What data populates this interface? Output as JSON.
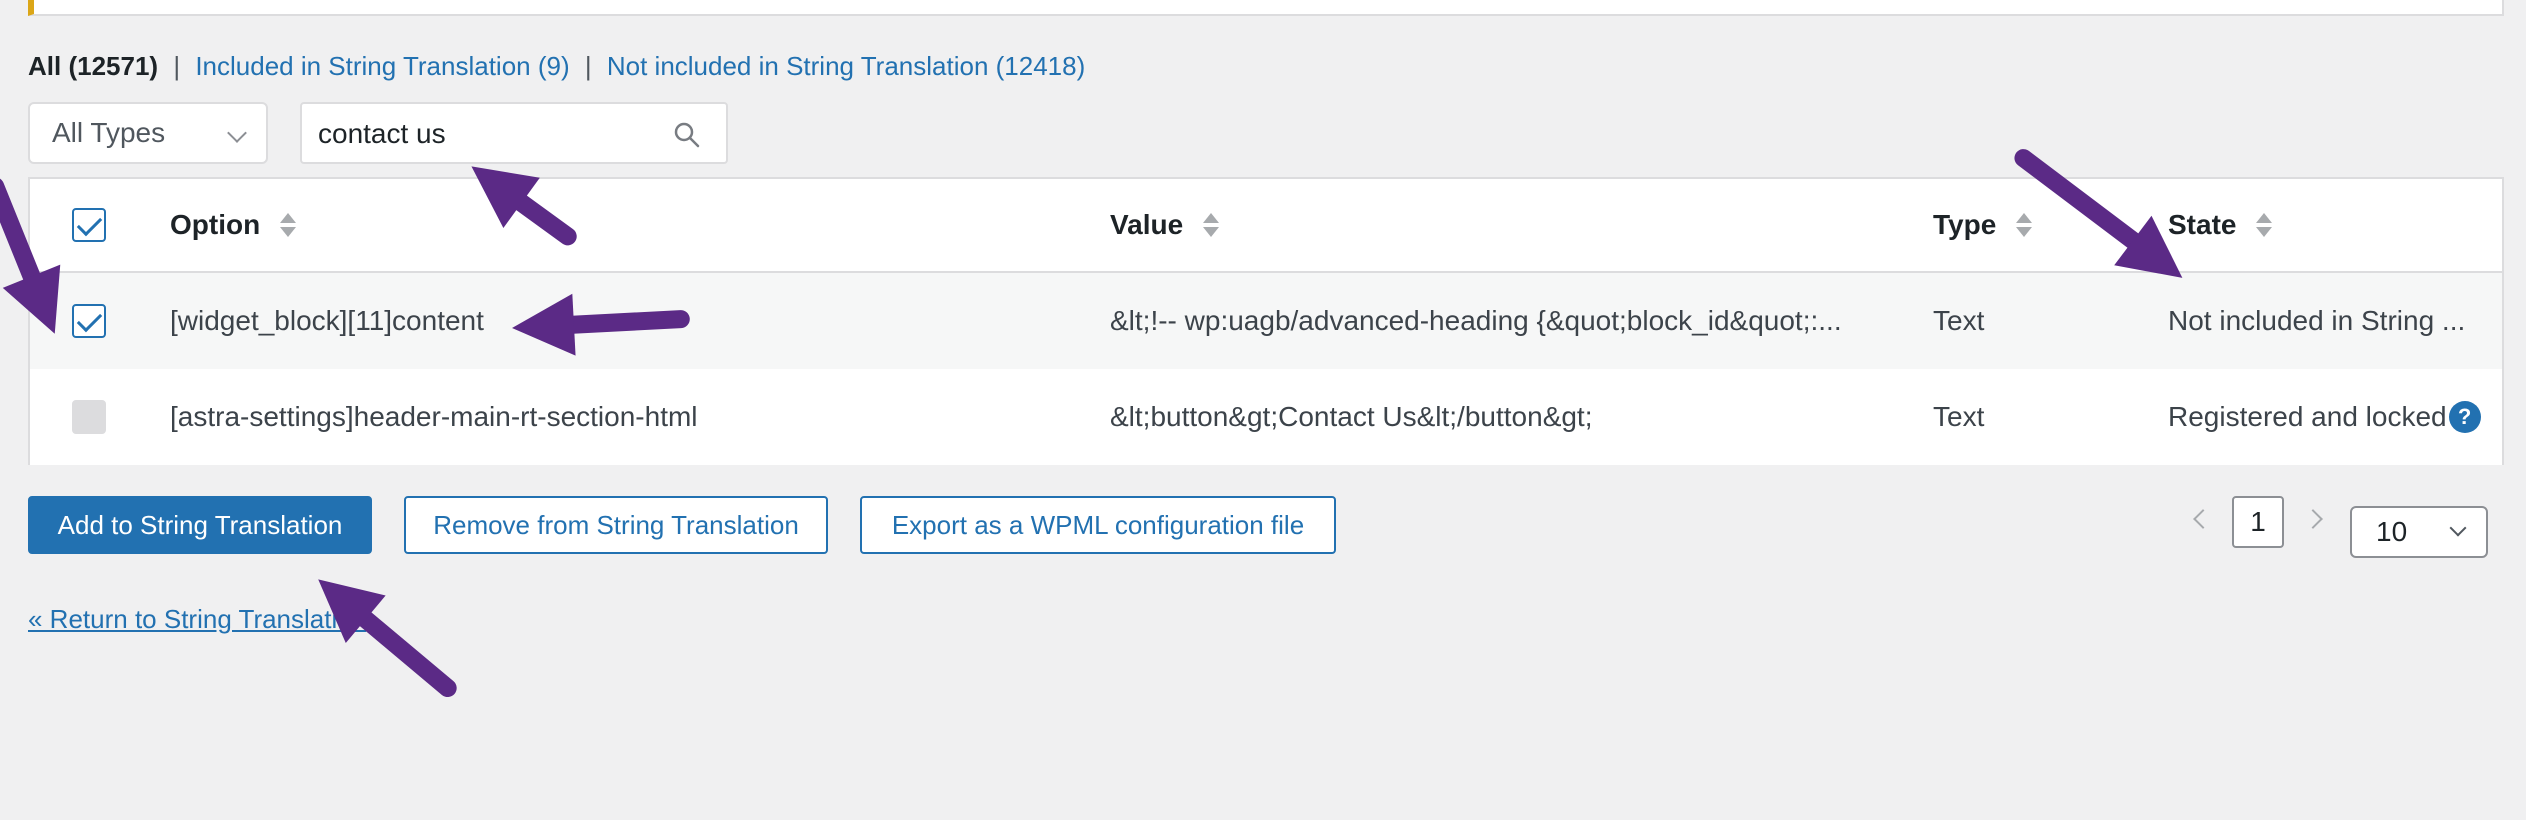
{
  "filters": {
    "all": "All (12571)",
    "sep1": "|",
    "included": "Included in String Translation (9)",
    "sep2": "|",
    "not_included": "Not included in String Translation (12418)"
  },
  "type_select": {
    "value": "All Types"
  },
  "search": {
    "value": "contact us"
  },
  "table": {
    "headers": {
      "option": "Option",
      "value": "Value",
      "type": "Type",
      "state": "State"
    },
    "rows": [
      {
        "option": "[widget_block][11]content",
        "value": "&lt;!-- wp:uagb/advanced-heading {&quot;block_id&quot;:...",
        "type": "Text",
        "state": "Not included in String ...",
        "checked": true
      },
      {
        "option": "[astra-settings]header-main-rt-section-html",
        "value": "&lt;button&gt;Contact Us&lt;/button&gt;",
        "type": "Text",
        "state": "Registered and locked",
        "help": "?",
        "checked": false
      }
    ]
  },
  "actions": {
    "add": "Add to String Translation",
    "remove": "Remove from String Translation",
    "export": "Export as a WPML configuration file"
  },
  "pagination": {
    "current_page": "1",
    "per_page": "10"
  },
  "return_link": "« Return to String Translation",
  "colors": {
    "accent": "#2271b1",
    "annotation_arrow": "#5b2a86",
    "notice_border": "#dba617"
  }
}
